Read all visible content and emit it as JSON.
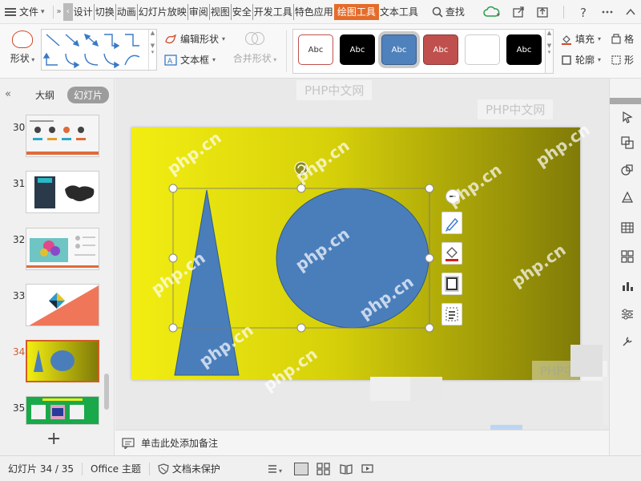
{
  "menu": {
    "file_label": "文件"
  },
  "tabs": [
    {
      "label": "设计"
    },
    {
      "label": "切换"
    },
    {
      "label": "动画"
    },
    {
      "label": "幻灯片放映"
    },
    {
      "label": "审阅"
    },
    {
      "label": "视图"
    },
    {
      "label": "安全"
    },
    {
      "label": "开发工具"
    },
    {
      "label": "特色应用"
    },
    {
      "label": "绘图工具",
      "active": true
    },
    {
      "label": "文本工具"
    }
  ],
  "search": {
    "label": "查找"
  },
  "ribbon": {
    "shape_label": "形状",
    "edit_shape_label": "编辑形状",
    "textbox_label": "文本框",
    "merge_shape_label": "合并形状",
    "shape_styles": [
      {
        "label": "Abc",
        "bg": "#ffffff",
        "fg": "#333333",
        "border": "#c0504d"
      },
      {
        "label": "Abc",
        "bg": "#000000",
        "fg": "#ffffff",
        "border": "#000000"
      },
      {
        "label": "Abc",
        "bg": "#4f81bd",
        "fg": "#ffffff",
        "border": "#385d8a",
        "selected": true
      },
      {
        "label": "Abc",
        "bg": "#c0504d",
        "fg": "#ffffff",
        "border": "#8c3836"
      },
      {
        "label": "",
        "bg": "#ffffff",
        "fg": "#333333",
        "border": "#cccccc"
      },
      {
        "label": "Abc",
        "bg": "#000000",
        "fg": "#ffffff",
        "border": "#000000"
      }
    ],
    "fill_label": "填充",
    "outline_label": "轮廓",
    "more1_label": "格",
    "more2_label": "形"
  },
  "left_panel": {
    "outline_tab": "大纲",
    "slides_tab": "幻灯片",
    "thumbnails": [
      {
        "number": "30"
      },
      {
        "number": "31"
      },
      {
        "number": "32"
      },
      {
        "number": "33"
      },
      {
        "number": "34",
        "current": true
      },
      {
        "number": "35"
      }
    ],
    "add_label": "+"
  },
  "notes": {
    "placeholder": "单击此处添加备注"
  },
  "status": {
    "slide_info": "幻灯片 34 / 35",
    "theme": "Office 主题",
    "protection": "文档未保护"
  },
  "watermarks": {
    "site": "php.cn",
    "site_cn": "PHP中文网"
  },
  "colors": {
    "accent": "#e46c2a",
    "shape_fill": "#4a7ebb",
    "shape_stroke": "#2e5b8a",
    "slide_yellow": "#f2ee12",
    "slide_olive": "#807b08"
  },
  "icons": {
    "menu": "hamburger-icon",
    "search": "search-icon",
    "cloud": "cloud-sync-icon",
    "share": "share-icon",
    "export": "export-icon",
    "help": "help-icon",
    "more": "more-icon",
    "collapse": "chevron-up-icon"
  }
}
